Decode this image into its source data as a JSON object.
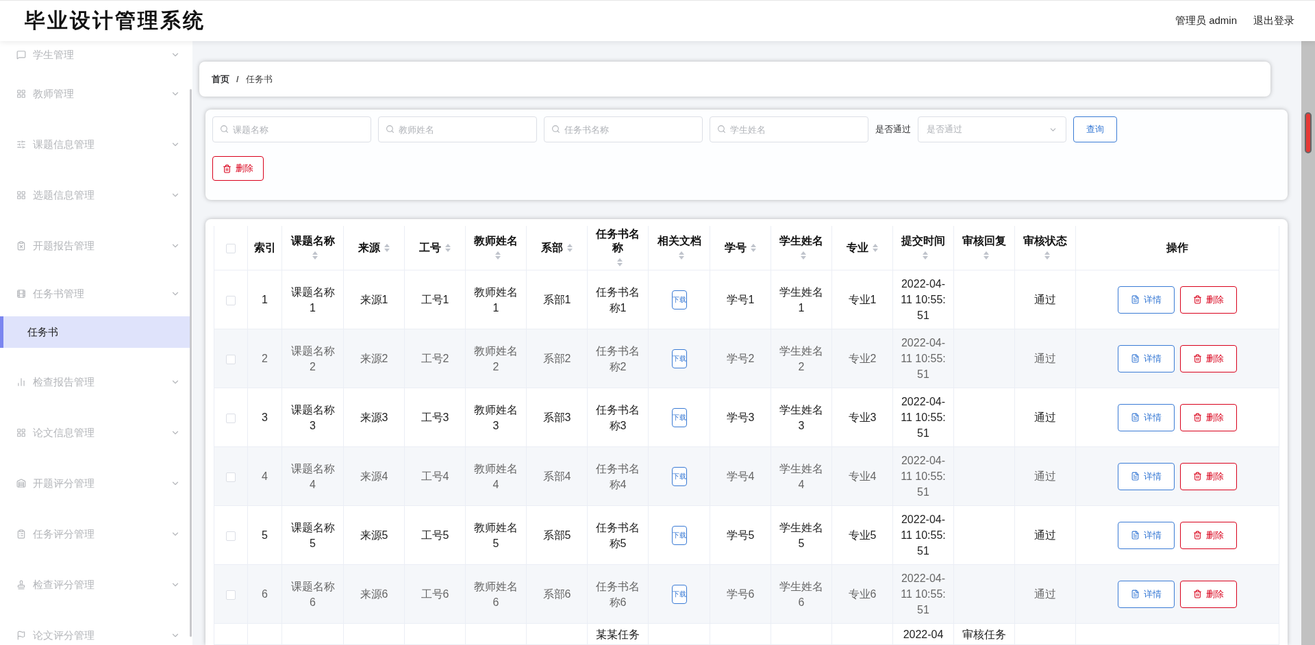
{
  "header": {
    "title": "毕业设计管理系统",
    "user": "管理员 admin",
    "logout": "退出登录"
  },
  "sidebar": {
    "items": [
      {
        "label": "学生管理",
        "expanded": false
      },
      {
        "label": "教师管理",
        "expanded": false
      },
      {
        "label": "课题信息管理",
        "expanded": false
      },
      {
        "label": "选题信息管理",
        "expanded": false
      },
      {
        "label": "开题报告管理",
        "expanded": false
      },
      {
        "label": "任务书管理",
        "expanded": true,
        "children": [
          {
            "label": "任务书",
            "selected": true
          }
        ]
      },
      {
        "label": "检查报告管理",
        "expanded": false
      },
      {
        "label": "论文信息管理",
        "expanded": false
      },
      {
        "label": "开题评分管理",
        "expanded": false
      },
      {
        "label": "任务评分管理",
        "expanded": false
      },
      {
        "label": "检查评分管理",
        "expanded": false
      },
      {
        "label": "论文评分管理",
        "expanded": false
      }
    ]
  },
  "breadcrumb": {
    "items": [
      "首页",
      "任务书"
    ],
    "separator": "/"
  },
  "filters": {
    "inputs": [
      {
        "placeholder": "课题名称"
      },
      {
        "placeholder": "教师姓名"
      },
      {
        "placeholder": "任务书名称"
      },
      {
        "placeholder": "学生姓名"
      }
    ],
    "select": {
      "label": "是否通过",
      "placeholder": "是否通过"
    },
    "search_button": "查询",
    "delete_button": "删除"
  },
  "table": {
    "select_all": {
      "checked": false
    },
    "columns": [
      {
        "label": "索引",
        "sortable": false
      },
      {
        "label": "课题名称",
        "sortable": true
      },
      {
        "label": "来源",
        "sortable": true
      },
      {
        "label": "工号",
        "sortable": true
      },
      {
        "label": "教师姓名",
        "sortable": true
      },
      {
        "label": "系部",
        "sortable": true
      },
      {
        "label": "任务书名称",
        "sortable": true
      },
      {
        "label": "相关文档",
        "sortable": true
      },
      {
        "label": "学号",
        "sortable": true
      },
      {
        "label": "学生姓名",
        "sortable": true
      },
      {
        "label": "专业",
        "sortable": true
      },
      {
        "label": "提交时间",
        "sortable": true
      },
      {
        "label": "审核回复",
        "sortable": true
      },
      {
        "label": "审核状态",
        "sortable": true
      },
      {
        "label": "操作",
        "sortable": false
      }
    ],
    "rows": [
      {
        "kind": "full",
        "checked": false,
        "index": "1",
        "topic": "课题名称1",
        "source": "来源1",
        "staff_no": "工号1",
        "teacher": "教师姓名1",
        "department": "系部1",
        "task_name": "任务书名称1",
        "download": "下载",
        "student_no": "学号1",
        "student": "学生姓名1",
        "major": "专业1",
        "submit_time": "2022-04-11 10:55:51",
        "review_status": "通过",
        "detail": "详情",
        "delete": "删除"
      },
      {
        "kind": "full",
        "checked": false,
        "index": "2",
        "topic": "课题名称2",
        "source": "来源2",
        "staff_no": "工号2",
        "teacher": "教师姓名2",
        "department": "系部2",
        "task_name": "任务书名称2",
        "download": "下载",
        "student_no": "学号2",
        "student": "学生姓名2",
        "major": "专业2",
        "submit_time": "2022-04-11 10:55:51",
        "review_status": "通过",
        "detail": "详情",
        "delete": "删除"
      },
      {
        "kind": "full",
        "checked": false,
        "index": "3",
        "topic": "课题名称3",
        "source": "来源3",
        "staff_no": "工号3",
        "teacher": "教师姓名3",
        "department": "系部3",
        "task_name": "任务书名称3",
        "download": "下载",
        "student_no": "学号3",
        "student": "学生姓名3",
        "major": "专业3",
        "submit_time": "2022-04-11 10:55:51",
        "review_status": "通过",
        "detail": "详情",
        "delete": "删除"
      },
      {
        "kind": "full",
        "checked": false,
        "index": "4",
        "topic": "课题名称4",
        "source": "来源4",
        "staff_no": "工号4",
        "teacher": "教师姓名4",
        "department": "系部4",
        "task_name": "任务书名称4",
        "download": "下载",
        "student_no": "学号4",
        "student": "学生姓名4",
        "major": "专业4",
        "submit_time": "2022-04-11 10:55:51",
        "review_status": "通过",
        "detail": "详情",
        "delete": "删除"
      },
      {
        "kind": "full",
        "checked": false,
        "index": "5",
        "topic": "课题名称5",
        "source": "来源5",
        "staff_no": "工号5",
        "teacher": "教师姓名5",
        "department": "系部5",
        "task_name": "任务书名称5",
        "download": "下载",
        "student_no": "学号5",
        "student": "学生姓名5",
        "major": "专业5",
        "submit_time": "2022-04-11 10:55:51",
        "review_status": "通过",
        "detail": "详情",
        "delete": "删除"
      },
      {
        "kind": "full",
        "checked": false,
        "index": "6",
        "topic": "课题名称6",
        "source": "来源6",
        "staff_no": "工号6",
        "teacher": "教师姓名6",
        "department": "系部6",
        "task_name": "任务书名称6",
        "download": "下载",
        "student_no": "学号6",
        "student": "学生姓名6",
        "major": "专业6",
        "submit_time": "2022-04-11 10:55:51",
        "review_status": "通过",
        "detail": "详情",
        "delete": "删除"
      },
      {
        "kind": "cut",
        "task_name": "某某任务",
        "submit_time": "2022-04",
        "review_reply": "审核任务"
      }
    ]
  }
}
